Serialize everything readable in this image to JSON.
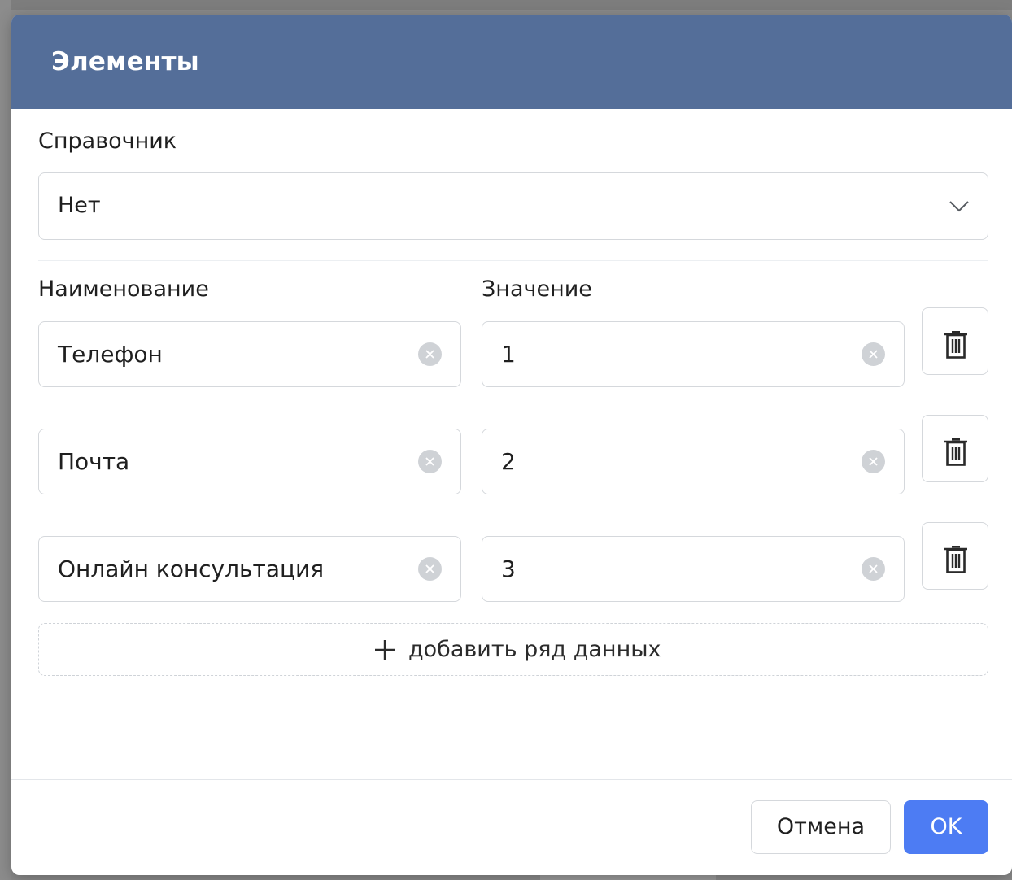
{
  "dialog": {
    "title": "Элементы"
  },
  "reference": {
    "label": "Справочник",
    "value": "Нет"
  },
  "columns": {
    "name": "Наименование",
    "value": "Значение"
  },
  "rows": [
    {
      "name": "Телефон",
      "value": "1"
    },
    {
      "name": "Почта",
      "value": "2"
    },
    {
      "name": "Онлайн консультация",
      "value": "3"
    }
  ],
  "add_row_label": "добавить ряд данных",
  "footer": {
    "cancel_label": "Отмена",
    "ok_label": "OK"
  },
  "colors": {
    "header": "#546e99",
    "primary": "#4d7cf3"
  },
  "icons": {
    "dropdown": "chevron-down-icon",
    "clear": "clear-circle-icon",
    "delete": "trash-icon",
    "add": "plus-icon"
  }
}
